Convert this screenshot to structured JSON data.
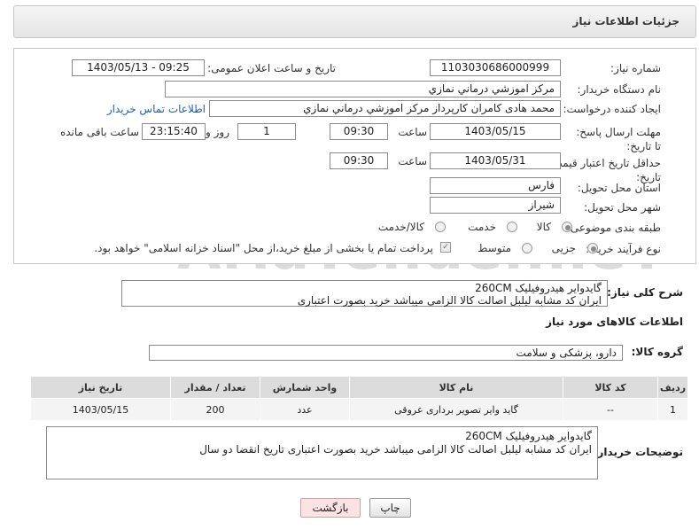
{
  "header": {
    "title": "جزئیات اطلاعات نیاز"
  },
  "form": {
    "need_number_label": "شماره نیاز:",
    "need_number": "1103030686000999",
    "announce_label": "تاریخ و ساعت اعلان عمومی:",
    "announce_value": "1403/05/13 - 09:25",
    "buyer_org_label": "نام دستگاه خریدار:",
    "buyer_org": "مرکز اموزشي درماني نمازي",
    "creator_label": "ایجاد کننده درخواست:",
    "creator": "محمد هادی کامران کارپرداز مرکز اموزشي درماني نمازي",
    "contact_link": "اطلاعات تماس خریدار",
    "reply_deadline_label": "مهلت ارسال پاسخ: تا تاریخ:",
    "reply_date": "1403/05/15",
    "time_label": "ساعت",
    "reply_time": "09:30",
    "days_value": "1",
    "days_label": "روز و",
    "remaining_time": "23:15:40",
    "remaining_label": "ساعت باقی مانده",
    "validity_label": "حداقل تاریخ اعتبار قیمت: تا تاریخ:",
    "validity_date": "1403/05/31",
    "validity_time_label": "ساعت",
    "validity_time": "09:30",
    "province_label": "استان محل تحویل:",
    "province": "فارس",
    "city_label": "شهر محل تحویل:",
    "city": "شیراز",
    "category_label": "طبقه بندی موضوعی:",
    "category_options": [
      "کالا",
      "خدمت",
      "کالا/خدمت"
    ],
    "category_selected": "کالا",
    "process_label": "نوع فرآیند خرید :",
    "process_options": [
      "جزیی",
      "متوسط"
    ],
    "process_selected": "جزیی",
    "payment_note": "پرداخت تمام یا بخشی از مبلغ خرید،از محل \"اسناد خزانه اسلامی\" خواهد بود."
  },
  "summary": {
    "label": "شرح کلی نیاز:",
    "line1": "گایدوایر هیدروفیلیک   260CM",
    "line2": "ایران کد مشابه لیلبل اصالت کالا الزامی میباشد خرید بصورت اعتباری"
  },
  "goods": {
    "section_title": "اطلاعات کالاهای مورد نیاز",
    "group_label": "گروه کالا:",
    "group_value": "دارو، پزشکی و سلامت",
    "table": {
      "headers": [
        "ردیف",
        "کد کالا",
        "نام کالا",
        "واحد شمارش",
        "تعداد / مقدار",
        "تاریخ نیاز"
      ],
      "rows": [
        [
          "1",
          "--",
          "گاید وایر تصویر برداری عروقی",
          "عدد",
          "200",
          "1403/05/15"
        ]
      ]
    }
  },
  "buyer_notes": {
    "label": "توضیحات خریدار:",
    "line1": "گایدوایر هیدروفیلیک   260CM",
    "line2": "ایران کد مشابه لیلبل اصالت کالا الزامی میباشد خرید بصورت اعتباری تاریخ انقضا دو سال"
  },
  "buttons": {
    "print": "چاپ",
    "back": "بازگشت"
  },
  "watermark": "AriaTender.neT",
  "colors": {
    "link": "#1a5fb4",
    "back_button_bg": "#fbe3e3"
  }
}
